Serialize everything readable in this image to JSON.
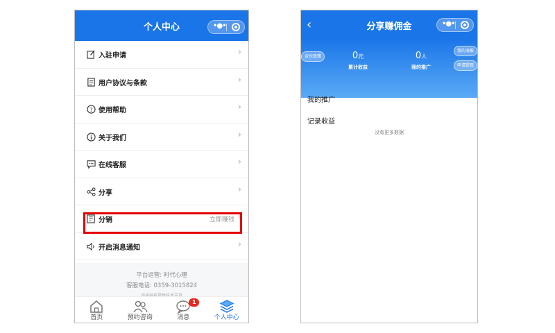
{
  "left": {
    "title": "个人中心",
    "menu": [
      {
        "label": "入驻申请",
        "icon": "edit-icon",
        "extra": ""
      },
      {
        "label": "用户协议与条款",
        "icon": "document-icon",
        "extra": ""
      },
      {
        "label": "使用帮助",
        "icon": "help-icon",
        "extra": ""
      },
      {
        "label": "关于我们",
        "icon": "info-icon",
        "extra": ""
      },
      {
        "label": "在线客服",
        "icon": "chat-icon",
        "extra": ""
      },
      {
        "label": "分享",
        "icon": "share-icon",
        "extra": ""
      },
      {
        "label": "分销",
        "icon": "distribution-icon",
        "extra": "立即赚钱"
      },
      {
        "label": "开启消息通知",
        "icon": "speaker-icon",
        "extra": ""
      }
    ],
    "footer": {
      "operator": "平台运营: 时代心理",
      "phone": "客服电话: 0359-3015824",
      "tech": "鸿途科技提供技术支持"
    },
    "tabs": [
      {
        "label": "首页",
        "icon": "home-icon"
      },
      {
        "label": "预约咨询",
        "icon": "people-icon"
      },
      {
        "label": "消息",
        "icon": "message-icon",
        "badge": "1"
      },
      {
        "label": "个人中心",
        "icon": "layers-icon",
        "active": true
      }
    ],
    "highlight_color": "#e30000"
  },
  "right": {
    "title": "分享赚佣金",
    "stats": [
      {
        "value": "0",
        "unit": "元",
        "caption": "累计收益"
      },
      {
        "value": "0",
        "unit": "人",
        "caption": "我的推广"
      }
    ],
    "pills": {
      "left": "合伙政策",
      "right_top": "我的海报",
      "right_bottom": "申请提现"
    },
    "sections": [
      "我的推广",
      "记录收益"
    ],
    "empty_text": "没有更多数据"
  },
  "colors": {
    "brand": "#1a75e8",
    "badge": "#e8261f"
  }
}
